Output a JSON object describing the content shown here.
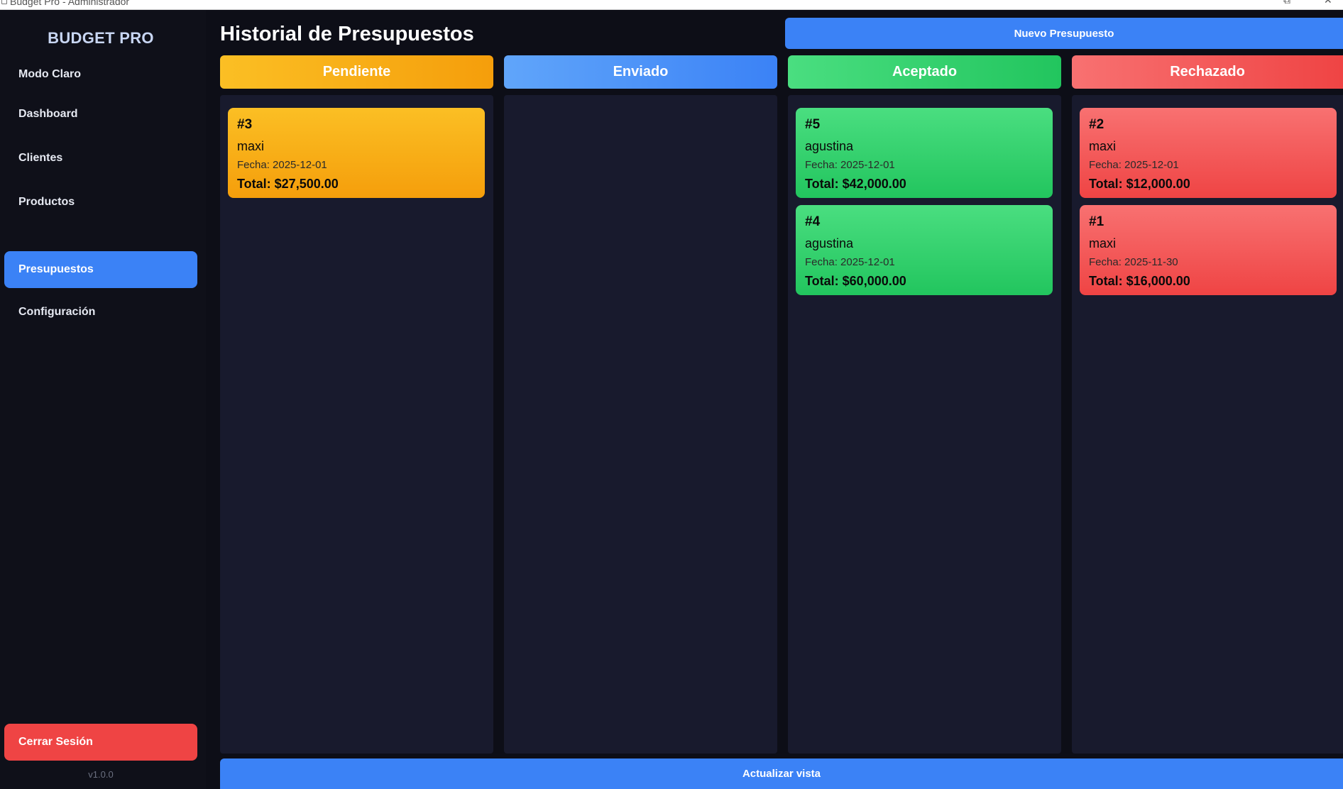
{
  "window": {
    "title": "Budget Pro - Administrador",
    "restore_glyph": "⧉",
    "close_glyph": "✕"
  },
  "sidebar": {
    "brand": "BUDGET PRO",
    "theme_toggle": "Modo Claro",
    "items": [
      {
        "label": "Dashboard",
        "active": false
      },
      {
        "label": "Clientes",
        "active": false
      },
      {
        "label": "Productos",
        "active": false
      },
      {
        "label": "Presupuestos",
        "active": true
      },
      {
        "label": "Configuración",
        "active": false
      }
    ],
    "logout_label": "Cerrar Sesión",
    "version": "v1.0.0"
  },
  "header": {
    "title": "Historial de Presupuestos",
    "new_button": "Nuevo Presupuesto"
  },
  "board": {
    "columns": [
      {
        "title": "Pendiente",
        "color": "#f59e0b",
        "cards": [
          {
            "id": "#3",
            "client": "maxi",
            "date": "Fecha: 2025-12-01",
            "total": "Total: $27,500.00"
          }
        ]
      },
      {
        "title": "Enviado",
        "color": "#3b82f6",
        "cards": []
      },
      {
        "title": "Aceptado",
        "color": "#22c55e",
        "cards": [
          {
            "id": "#5",
            "client": "agustina",
            "date": "Fecha: 2025-12-01",
            "total": "Total: $42,000.00"
          },
          {
            "id": "#4",
            "client": "agustina",
            "date": "Fecha: 2025-12-01",
            "total": "Total: $60,000.00"
          }
        ]
      },
      {
        "title": "Rechazado",
        "color": "#ef4444",
        "cards": [
          {
            "id": "#2",
            "client": "maxi",
            "date": "Fecha: 2025-12-01",
            "total": "Total: $12,000.00"
          },
          {
            "id": "#1",
            "client": "maxi",
            "date": "Fecha: 2025-11-30",
            "total": "Total: $16,000.00"
          }
        ]
      }
    ]
  },
  "footer": {
    "refresh_button": "Actualizar vista"
  }
}
